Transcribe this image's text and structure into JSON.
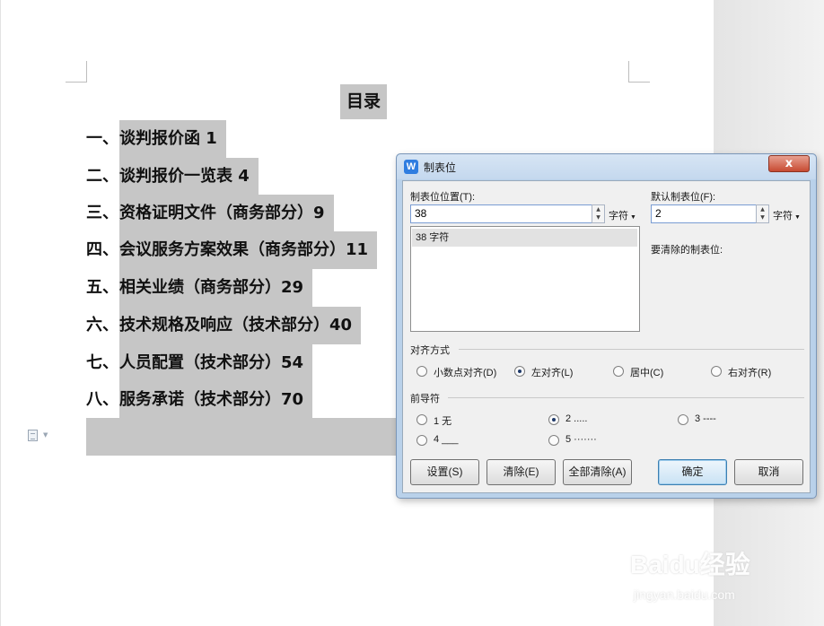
{
  "document": {
    "title": "目录",
    "toc": [
      {
        "num": "一、",
        "text": "谈判报价函 1"
      },
      {
        "num": "二、",
        "text": "谈判报价一览表 4"
      },
      {
        "num": "三、",
        "text": "资格证明文件（商务部分）9"
      },
      {
        "num": "四、",
        "text": "会议服务方案效果（商务部分）11"
      },
      {
        "num": "五、",
        "text": "相关业绩（商务部分）29"
      },
      {
        "num": "六、",
        "text": "技术规格及响应（技术部分）40"
      },
      {
        "num": "七、",
        "text": "人员配置（技术部分）54"
      },
      {
        "num": "八、",
        "text": "服务承诺（技术部分）70"
      }
    ]
  },
  "dialog": {
    "title": "制表位",
    "app_icon": "W",
    "close_label": "x",
    "tab_position_label": "制表位位置(T):",
    "tab_position_value": "38",
    "tab_position_unit": "字符",
    "tab_list": [
      "38 字符"
    ],
    "default_tab_label": "默认制表位(F):",
    "default_tab_value": "2",
    "default_tab_unit": "字符",
    "clear_label": "要清除的制表位:",
    "alignment_label": "对齐方式",
    "alignment_options": [
      {
        "label": "小数点对齐(D)",
        "selected": false
      },
      {
        "label": "左对齐(L)",
        "selected": true
      },
      {
        "label": "居中(C)",
        "selected": false
      },
      {
        "label": "右对齐(R)",
        "selected": false
      }
    ],
    "leader_label": "前导符",
    "leader_options": [
      {
        "label": "1 无",
        "selected": false
      },
      {
        "label": "2 .....",
        "selected": true
      },
      {
        "label": "3 ----",
        "selected": false
      },
      {
        "label": "4 ___",
        "selected": false
      },
      {
        "label": "5 ·······",
        "selected": false
      }
    ],
    "buttons": {
      "set": "设置(S)",
      "clear": "清除(E)",
      "clear_all": "全部清除(A)",
      "ok": "确定",
      "cancel": "取消"
    }
  },
  "watermark": {
    "logo": "Baidu经验",
    "url": "jingyan.baidu.com"
  },
  "colors": {
    "highlight": "#c6c6c6",
    "dialog_frame": "#b9d1ea",
    "close_button": "#c74a32"
  },
  "icons": [
    "doc-icon",
    "app-icon",
    "close-icon",
    "spin-up-icon",
    "spin-down-icon",
    "dropdown-icon"
  ]
}
